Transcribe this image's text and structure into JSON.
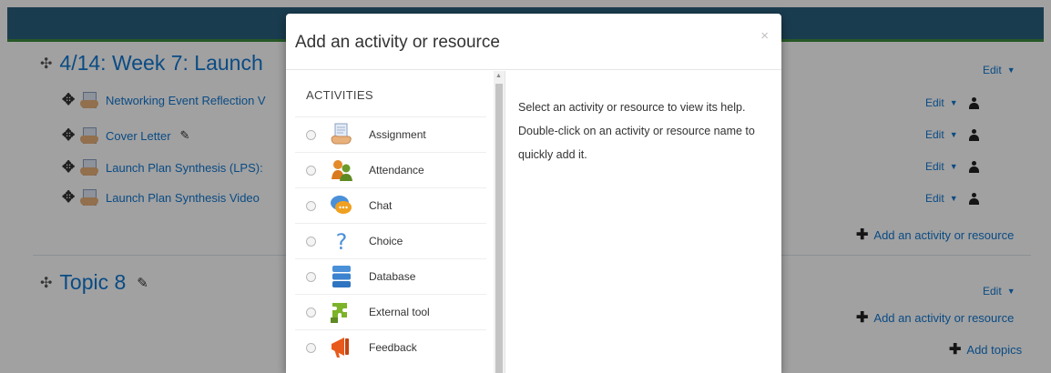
{
  "background": {
    "section1": {
      "title": "4/14: Week 7: Launch",
      "edit_label": "Edit",
      "activities": [
        {
          "label": "Networking Event Reflection V",
          "edit_label": "Edit"
        },
        {
          "label": "Cover Letter",
          "edit_label": "Edit"
        },
        {
          "label": "Launch Plan Synthesis (LPS):",
          "edit_label": "Edit"
        },
        {
          "label": "Launch Plan Synthesis Video",
          "edit_label": "Edit"
        }
      ],
      "add_label": "Add an activity or resource"
    },
    "section2": {
      "title": "Topic 8",
      "edit_label": "Edit",
      "add_label": "Add an activity or resource",
      "add_topics_label": "Add topics"
    }
  },
  "modal": {
    "title": "Add an activity or resource",
    "close_symbol": "×",
    "list_header": "ACTIVITIES",
    "options": [
      {
        "label": "Assignment",
        "icon": "assignment-icon"
      },
      {
        "label": "Attendance",
        "icon": "attendance-icon"
      },
      {
        "label": "Chat",
        "icon": "chat-icon"
      },
      {
        "label": "Choice",
        "icon": "choice-icon"
      },
      {
        "label": "Database",
        "icon": "database-icon"
      },
      {
        "label": "External tool",
        "icon": "external-tool-icon"
      },
      {
        "label": "Feedback",
        "icon": "feedback-icon"
      }
    ],
    "help_text": "Select an activity or resource to view its help. Double-click on an activity or resource name to quickly add it."
  },
  "colors": {
    "accent": "#1177d1",
    "header_bar": "#2a5f7d",
    "header_stripe": "#3d8c3d"
  }
}
